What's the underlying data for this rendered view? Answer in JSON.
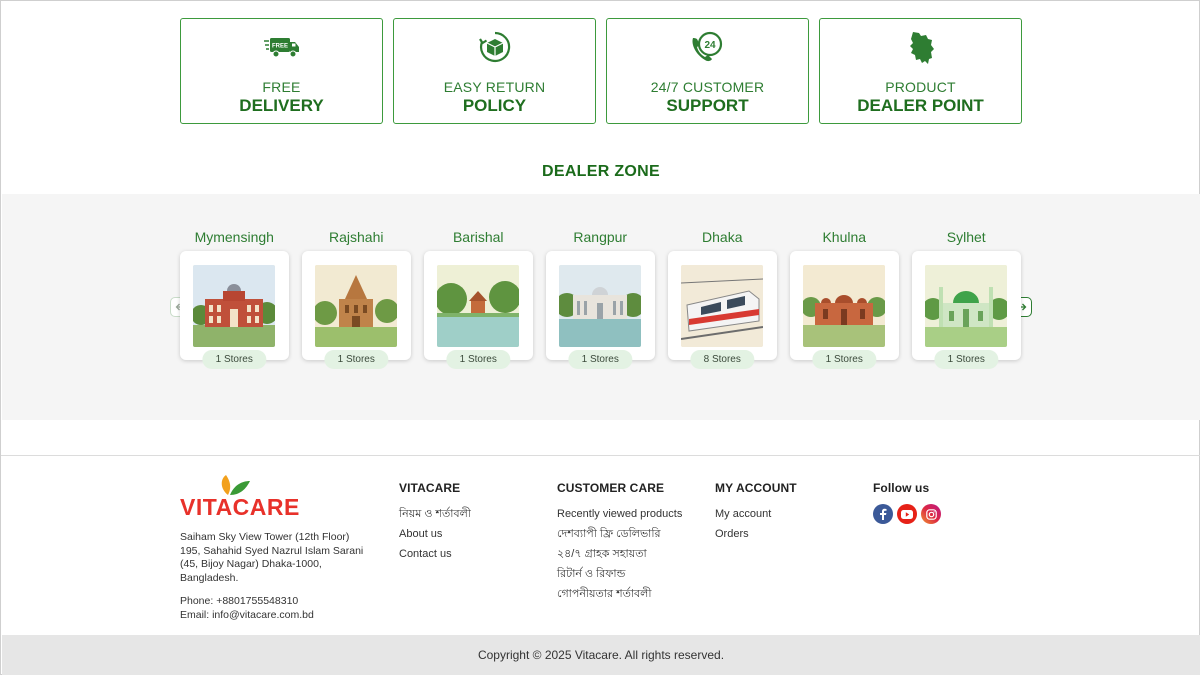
{
  "features": [
    {
      "small": "FREE",
      "big": "DELIVERY",
      "icon": "truck-free-icon"
    },
    {
      "small": "EASY RETURN",
      "big": "POLICY",
      "icon": "return-box-icon"
    },
    {
      "small": "24/7 CUSTOMER",
      "big": "SUPPORT",
      "icon": "phone-24-icon"
    },
    {
      "small": "PRODUCT",
      "big": "DEALER POINT",
      "icon": "bangladesh-map-icon"
    }
  ],
  "feature_icon_text": {
    "free": "FREE",
    "hours": "24"
  },
  "dealer_zone": {
    "title": "DEALER ZONE",
    "dealers": [
      {
        "name": "Mymensingh",
        "stores": "1 Stores"
      },
      {
        "name": "Rajshahi",
        "stores": "1 Stores"
      },
      {
        "name": "Barishal",
        "stores": "1 Stores"
      },
      {
        "name": "Rangpur",
        "stores": "1 Stores"
      },
      {
        "name": "Dhaka",
        "stores": "8 Stores"
      },
      {
        "name": "Khulna",
        "stores": "1 Stores"
      },
      {
        "name": "Sylhet",
        "stores": "1 Stores"
      }
    ]
  },
  "footer": {
    "logo_text": "VITACARE",
    "address": [
      "Saiham Sky View Tower (12th Floor)",
      "195, Sahahid Syed Nazrul Islam Sarani",
      "(45, Bijoy Nagar) Dhaka-1000,",
      "Bangladesh."
    ],
    "phone": "Phone: +8801755548310",
    "email": "Email: info@vitacare.com.bd",
    "vitacare": {
      "title": "VITACARE",
      "links": [
        "নিয়ম ও শর্তাবলী",
        "About us",
        "Contact us"
      ]
    },
    "customer_care": {
      "title": "CUSTOMER CARE",
      "links": [
        "Recently viewed products",
        "দেশব্যাপী ফ্রি ডেলিভারি",
        "২৪/৭ গ্রাহক সহায়তা",
        "রিটার্ন ও রিফান্ড",
        "গোপনীয়তার শর্তাবলী"
      ]
    },
    "my_account": {
      "title": "MY ACCOUNT",
      "links": [
        "My account",
        "Orders"
      ]
    },
    "follow": {
      "title": "Follow us"
    }
  },
  "copyright": "Copyright © 2025 Vitacare. All rights reserved.",
  "colors": {
    "brand_green": "#2e7d32",
    "logo_red": "#e8312a",
    "facebook": "#3b5998",
    "youtube": "#e62117",
    "instagram": "#c13584"
  }
}
